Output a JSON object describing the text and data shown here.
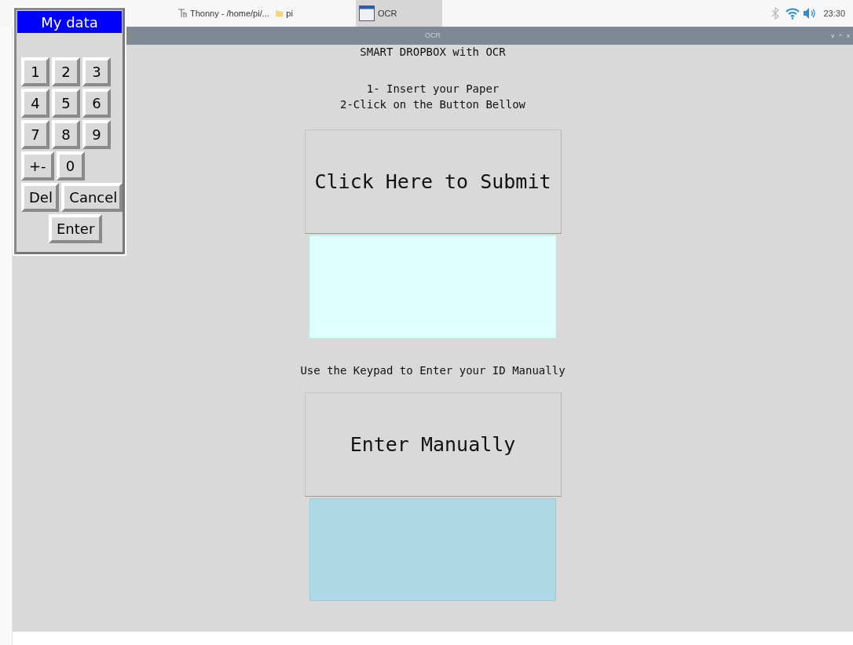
{
  "taskbar": {
    "tasks": [
      {
        "label": "Thonny - /home/pi/...",
        "kind": "thonny",
        "selected": false
      },
      {
        "label": "pi",
        "kind": "folder",
        "selected": false
      },
      {
        "label": "OCR",
        "kind": "window",
        "selected": true
      }
    ],
    "clock": "23:30"
  },
  "window": {
    "title": "OCR",
    "controls": [
      "v",
      "^",
      "x"
    ]
  },
  "content": {
    "heading": "SMART DROPBOX with OCR",
    "instructions": [
      "1- Insert your Paper",
      "2-Click on the Button Bellow"
    ],
    "submit_button": "Click Here to Submit",
    "keypad_hint": "Use the Keypad to Enter your ID Manually",
    "manual_button": "Enter Manually"
  },
  "keypad": {
    "title": "My data",
    "rows": [
      [
        "1",
        "2",
        "3"
      ],
      [
        "4",
        "5",
        "6"
      ],
      [
        "7",
        "8",
        "9"
      ],
      [
        "+-",
        "0"
      ],
      [
        "Del",
        "Cancel"
      ],
      [
        "",
        "Enter"
      ]
    ]
  }
}
